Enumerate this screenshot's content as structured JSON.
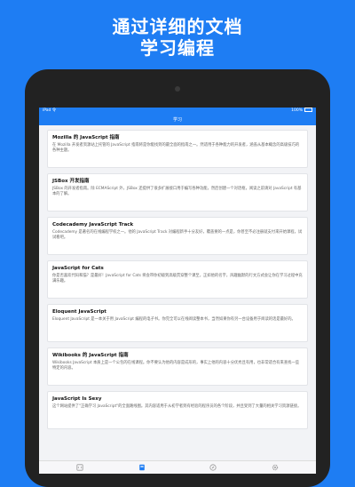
{
  "promo": {
    "line1": "通过详细的文档",
    "line2": "学习编程"
  },
  "status": {
    "left": "iPad 令",
    "right": "100%"
  },
  "nav": {
    "title": "学习"
  },
  "cards": [
    {
      "title": "Mozilla 的 JavaScript 指南",
      "desc": "在 Mozilla 开发者资源站上托管的 JavaScript 指南将是你能找到的最全面的指南之一。然适用于各种能力的开发者，涵盖从基本概念的高级技巧的各种主题。"
    },
    {
      "title": "JSBox 开发指南",
      "desc": "JSBox 的开发者指南。除 ECMAScript 外，JSBox 还提供了很多扩展接口用于编写各种功能，然后创建一个对话框，阅读之前请对 JavaScript 有基本的了解。"
    },
    {
      "title": "Codecademy JavaScript Track",
      "desc": "Codecademy 是著名的在线编程学校之一。他的 JavaScript Track 对编程新手十分友好，覆盖要的一点是，你甚至不必注册就支付来开始课程，试试看吧。"
    },
    {
      "title": "JavaScript for Cats",
      "desc": "你是否喜欢代码和猫？是最好！JavaScript for Cats 将会带你初级到高级贯穿整个课至，正如他的名字，风趣幽默的行文方式会让你在学习过程中充满乐趣。"
    },
    {
      "title": "Eloquent JavaScript",
      "desc": "Eloquent JavaScript 是一本关于用 JavaScript 编程的电子书。你完全可以在线阅读整本书，当然如果你有另一台设备用于阅读的话是最好的。"
    },
    {
      "title": "Wikibooks 的 JavaScript 指南",
      "desc": "Wikibooks JavaScript 本质上是一个公包的在线课程。你不要认为他的内容是成形的，事实上他的内容十分优秀且有用，也非常适合有来查找一些特定的内容。"
    },
    {
      "title": "JavaScript Is Sexy",
      "desc": "这个网站提供了\"正确学习 JavaScript\"的全面路线图。其内容适用于从初学者到有经验的程序员的各个阶段，并且受到了大量的相关学习资源链接。"
    }
  ],
  "tabs": [
    {
      "icon": "code-icon"
    },
    {
      "icon": "book-icon"
    },
    {
      "icon": "compass-icon"
    },
    {
      "icon": "gear-icon"
    }
  ],
  "colors": {
    "brand": "#1e7df3",
    "active_tab": "#1e7df3",
    "inactive_tab": "#9a9a9a"
  }
}
